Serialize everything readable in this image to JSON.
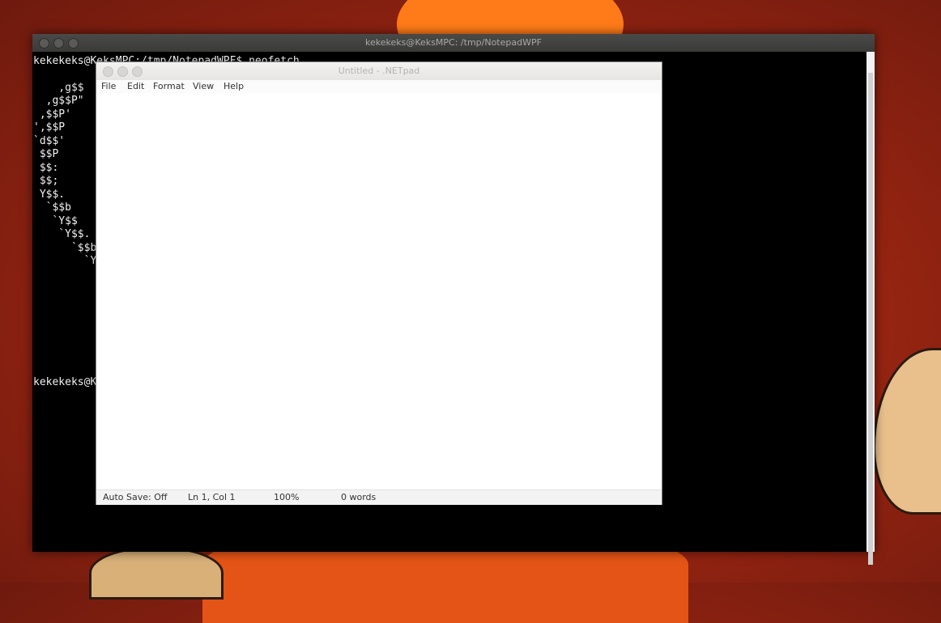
{
  "terminal": {
    "title": "kekekeks@KeksMPC: /tmp/NotepadWPF",
    "command_line": "kekekeks@KeksMPC:/tmp/NotepadWPF$ neofetch",
    "ascii_art": [
      "    ,g$$",
      "  ,g$$P\"",
      " ,$$P'",
      "',$$P",
      "`d$$'",
      " $$P",
      " $$:",
      " $$;",
      " Y$$.",
      "  `$$b",
      "   `Y$$",
      "    `Y$$.",
      "      `$$b",
      "        `Y"
    ],
    "prompt_line": "kekekeks@KeksMPC:/tmp/NotepadWPF$"
  },
  "notepad": {
    "title": "Untitled - .NETpad",
    "menu": [
      "File",
      "Edit",
      "Format",
      "View",
      "Help"
    ],
    "content": "",
    "status": {
      "auto_save": "Auto Save: Off",
      "position": "Ln 1, Col 1",
      "zoom": "100%",
      "words": "0 words"
    }
  }
}
